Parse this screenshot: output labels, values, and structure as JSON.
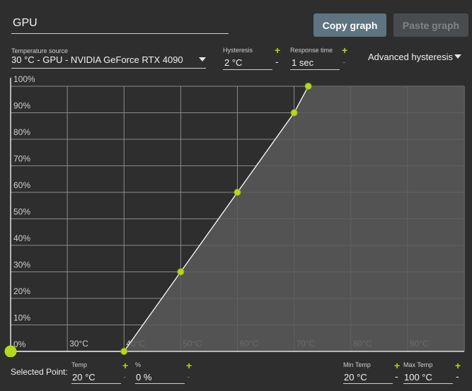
{
  "header": {
    "title": "GPU",
    "copy_label": "Copy graph",
    "paste_label": "Paste graph"
  },
  "controls": {
    "temp_source_label": "Temperature source",
    "temp_source_value": "30 °C - GPU - NVIDIA GeForce RTX 4090",
    "hysteresis_label": "Hysteresis",
    "hysteresis_value": "2 °C",
    "response_label": "Response time",
    "response_value": "1 sec",
    "advanced_label": "Advanced hysteresis",
    "plus": "+",
    "minus": "-"
  },
  "chart_data": {
    "type": "line",
    "x_tick_labels": [
      "30°C",
      "40°C",
      "50°C",
      "60°C",
      "70°C",
      "80°C",
      "90°C"
    ],
    "y_tick_labels": [
      "0%",
      "10%",
      "20%",
      "30%",
      "40%",
      "50%",
      "60%",
      "70%",
      "80%",
      "90%",
      "100%"
    ],
    "xlim": [
      20,
      100
    ],
    "ylim": [
      0,
      100
    ],
    "grid": true,
    "points": [
      {
        "x": 20,
        "y": 0
      },
      {
        "x": 40,
        "y": 0
      },
      {
        "x": 50,
        "y": 30
      },
      {
        "x": 60,
        "y": 60
      },
      {
        "x": 70,
        "y": 90
      },
      {
        "x": 72.5,
        "y": 100
      }
    ],
    "selected_index": 0,
    "accent": "#b4d81e"
  },
  "footer": {
    "selected_label": "Selected Point:",
    "temp_label": "Temp",
    "temp_value": "20 °C",
    "percent_label": "%",
    "percent_value": "0 %",
    "min_temp_label": "Min Temp",
    "min_temp_value": "20 °C",
    "max_temp_label": "Max Temp",
    "max_temp_value": "100 °C"
  }
}
